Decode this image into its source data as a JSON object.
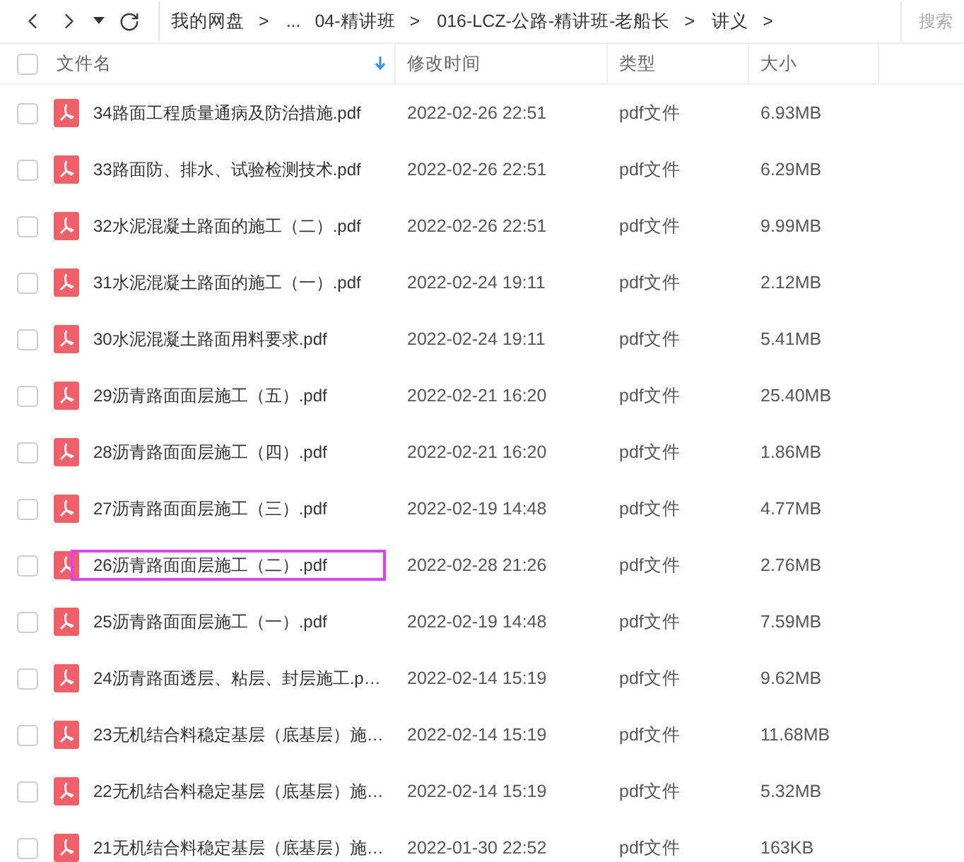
{
  "breadcrumb": [
    {
      "label": "我的网盘",
      "separator": ">"
    },
    {
      "label": "..."
    },
    {
      "label": "04-精讲班",
      "separator": ">"
    },
    {
      "label": "016-LCZ-公路-精讲班-老船长",
      "separator": ">"
    },
    {
      "label": "讲义",
      "separator": ">"
    }
  ],
  "search": {
    "placeholder": "搜索"
  },
  "header": {
    "checked": false,
    "columns": [
      {
        "label": "文件名",
        "sorted": true
      },
      {
        "label": "修改时间",
        "sorted": false
      },
      {
        "label": "类型",
        "sorted": false
      },
      {
        "label": "大小",
        "sorted": false
      }
    ]
  },
  "rows": [
    {
      "name": "34路面工程质量通病及防治措施.pdf",
      "modified": "2022-02-26 22:51",
      "type": "pdf文件",
      "size": "6.93MB",
      "checked": false,
      "highlighted": false
    },
    {
      "name": "33路面防、排水、试验检测技术.pdf",
      "modified": "2022-02-26 22:51",
      "type": "pdf文件",
      "size": "6.29MB",
      "checked": false,
      "highlighted": false
    },
    {
      "name": "32水泥混凝土路面的施工（二）.pdf",
      "modified": "2022-02-26 22:51",
      "type": "pdf文件",
      "size": "9.99MB",
      "checked": false,
      "highlighted": false
    },
    {
      "name": "31水泥混凝土路面的施工（一）.pdf",
      "modified": "2022-02-24 19:11",
      "type": "pdf文件",
      "size": "2.12MB",
      "checked": false,
      "highlighted": false
    },
    {
      "name": "30水泥混凝土路面用料要求.pdf",
      "modified": "2022-02-24 19:11",
      "type": "pdf文件",
      "size": "5.41MB",
      "checked": false,
      "highlighted": false
    },
    {
      "name": "29沥青路面面层施工（五）.pdf",
      "modified": "2022-02-21 16:20",
      "type": "pdf文件",
      "size": "25.40MB",
      "checked": false,
      "highlighted": false
    },
    {
      "name": "28沥青路面面层施工（四）.pdf",
      "modified": "2022-02-21 16:20",
      "type": "pdf文件",
      "size": "1.86MB",
      "checked": false,
      "highlighted": false
    },
    {
      "name": "27沥青路面面层施工（三）.pdf",
      "modified": "2022-02-19 14:48",
      "type": "pdf文件",
      "size": "4.77MB",
      "checked": false,
      "highlighted": false
    },
    {
      "name": "26沥青路面面层施工（二）.pdf",
      "modified": "2022-02-28 21:26",
      "type": "pdf文件",
      "size": "2.76MB",
      "checked": false,
      "highlighted": true
    },
    {
      "name": "25沥青路面面层施工（一）.pdf",
      "modified": "2022-02-19 14:48",
      "type": "pdf文件",
      "size": "7.59MB",
      "checked": false,
      "highlighted": false
    },
    {
      "name": "24沥青路面透层、粘层、封层施工.p…",
      "modified": "2022-02-14 15:19",
      "type": "pdf文件",
      "size": "9.62MB",
      "checked": false,
      "highlighted": false
    },
    {
      "name": "23无机结合料稳定基层（底基层）施…",
      "modified": "2022-02-14 15:19",
      "type": "pdf文件",
      "size": "11.68MB",
      "checked": false,
      "highlighted": false
    },
    {
      "name": "22无机结合料稳定基层（底基层）施…",
      "modified": "2022-02-14 15:19",
      "type": "pdf文件",
      "size": "5.32MB",
      "checked": false,
      "highlighted": false
    },
    {
      "name": "21无机结合料稳定基层（底基层）施…",
      "modified": "2022-01-30 22:52",
      "type": "pdf文件",
      "size": "163KB",
      "checked": false,
      "highlighted": false
    }
  ]
}
